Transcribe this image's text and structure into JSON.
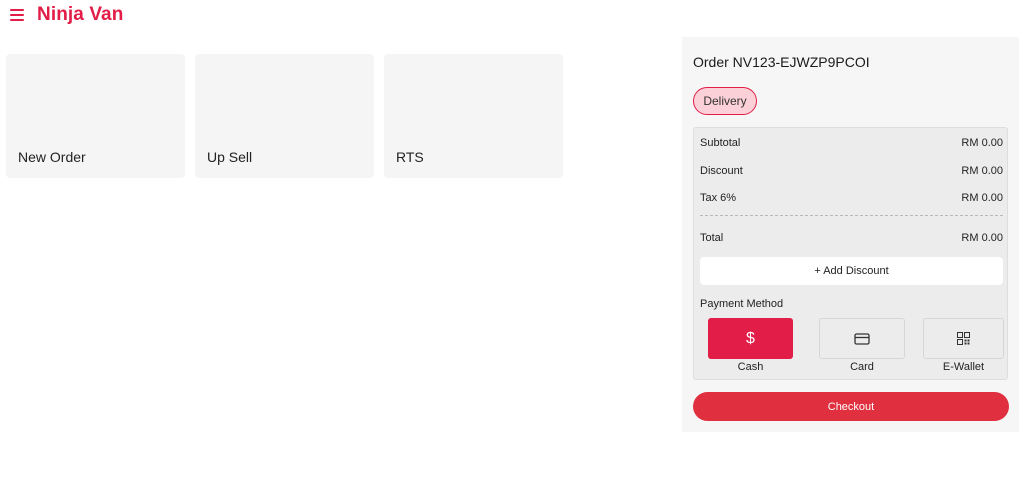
{
  "header": {
    "brand": "Ninja Van",
    "menu_icon": "hamburger-menu-icon"
  },
  "tiles": [
    {
      "label": "New Order"
    },
    {
      "label": "Up Sell"
    },
    {
      "label": "RTS"
    }
  ],
  "order": {
    "title": "Order NV123-EJWZP9PCOI",
    "type_badge": "Delivery",
    "summary": {
      "subtotal_label": "Subtotal",
      "subtotal_value": "RM 0.00",
      "discount_label": "Discount",
      "discount_value": "RM 0.00",
      "tax_label": "Tax 6%",
      "tax_value": "RM 0.00",
      "total_label": "Total",
      "total_value": "RM 0.00"
    },
    "add_discount_label": "+ Add Discount",
    "payment_method_label": "Payment Method",
    "payment_methods": [
      {
        "label": "Cash",
        "icon": "dollar-icon",
        "glyph": "$",
        "selected": true
      },
      {
        "label": "Card",
        "icon": "credit-card-icon",
        "selected": false
      },
      {
        "label": "E-Wallet",
        "icon": "qr-code-icon",
        "selected": false
      }
    ],
    "checkout_label": "Checkout"
  },
  "colors": {
    "accent": "#e11d48",
    "badge_bg": "#fbd0d6",
    "checkout": "#e0303f",
    "tile_bg": "#f5f5f5",
    "panel_bg": "#f6f6f6"
  }
}
